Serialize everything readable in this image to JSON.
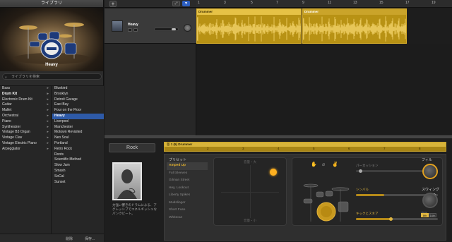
{
  "library": {
    "title": "ライブラリ",
    "preset_name": "Heavy",
    "search_placeholder": "ライブラリを検索",
    "categories": [
      {
        "label": "Bass"
      },
      {
        "label": "Drum Kit"
      },
      {
        "label": "Electronic Drum Kit"
      },
      {
        "label": "Guitar"
      },
      {
        "label": "Mallet"
      },
      {
        "label": "Orchestral"
      },
      {
        "label": "Piano"
      },
      {
        "label": "Synthesizer"
      },
      {
        "label": "Vintage B3 Organ"
      },
      {
        "label": "Vintage Clav"
      },
      {
        "label": "Vintage Electric Piano"
      },
      {
        "label": "Arpeggiator"
      }
    ],
    "subcategories": [
      {
        "label": "Bluebird"
      },
      {
        "label": "Brooklyn"
      },
      {
        "label": "Detroit Garage"
      },
      {
        "label": "East Bay"
      },
      {
        "label": "Four on the Floor"
      },
      {
        "label": "Heavy"
      },
      {
        "label": "Liverpool"
      },
      {
        "label": "Manchester"
      },
      {
        "label": "Motown Revisited"
      },
      {
        "label": "Neo Soul"
      },
      {
        "label": "Portland"
      },
      {
        "label": "Retro Rock"
      },
      {
        "label": "Roots"
      },
      {
        "label": "Scientific Method"
      },
      {
        "label": "Slow Jam"
      },
      {
        "label": "Smash"
      },
      {
        "label": "SoCal"
      },
      {
        "label": "Sunset"
      }
    ],
    "footer": {
      "delete": "削除",
      "save": "保存..."
    }
  },
  "toolbar": {
    "add_track": "+",
    "btn1": "⤢",
    "btn2": "▼"
  },
  "ruler": {
    "ticks": [
      "1",
      "3",
      "5",
      "7",
      "9",
      "11",
      "13",
      "15",
      "17",
      "19"
    ]
  },
  "track": {
    "name": "Heavy"
  },
  "regions": [
    {
      "title": "Drummer"
    },
    {
      "title": "Drummer"
    }
  ],
  "editor": {
    "genre": "Rock",
    "drummer_desc": "力強い響きのドラムによる、アグレッシブでエネルギッシュなパンクビート。",
    "drum_bar_title": "ⓑ 1 (5) Drummer",
    "drum_bar_ticks": [
      "2",
      "3",
      "4",
      "5",
      "6",
      "7",
      "8"
    ],
    "preset_header": "プリセット",
    "presets": [
      {
        "label": "Amped Up"
      },
      {
        "label": "Full Sleeves"
      },
      {
        "label": "Gilman Street"
      },
      {
        "label": "Hey, Lookout"
      },
      {
        "label": "Liberty Spikes"
      },
      {
        "label": "Mudslinger"
      },
      {
        "label": "Short Fuse"
      },
      {
        "label": "Whiteout"
      }
    ],
    "xy_top": "音量・大",
    "xy_bottom": "音量・小",
    "lanes": [
      {
        "label": "パーカッション"
      },
      {
        "label": "シンバル"
      },
      {
        "label": "キックとスネア"
      }
    ],
    "kick_follow": "追従",
    "fill_label": "フィル",
    "swing_label": "スウィング",
    "swing_btns": [
      "8th",
      "16th"
    ]
  },
  "colors": {
    "region": "#b89214",
    "accent": "#e0b640",
    "selection": "#2e5aa8"
  }
}
